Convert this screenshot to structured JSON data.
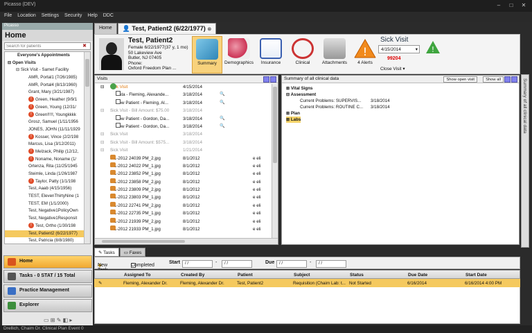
{
  "window": {
    "title": "Picasso (DEV)"
  },
  "menu": [
    "File",
    "Location",
    "Settings",
    "Security",
    "Help",
    "DDC"
  ],
  "left": {
    "app_label": "Picasso",
    "home_title": "Home",
    "search_placeholder": "Search for patients",
    "tree": [
      {
        "text": "Everyone's Appointments",
        "bold": true,
        "alert": false,
        "indent": 18
      },
      {
        "text": "⊟ Open Visits",
        "bold": true,
        "alert": false,
        "indent": 4
      },
      {
        "text": "⊟ Sick Visit - Samet Facility",
        "bold": false,
        "alert": false,
        "indent": 16
      },
      {
        "text": "AMR, Portal1 (7/26/1985)",
        "bold": false,
        "alert": false,
        "indent": 34
      },
      {
        "text": "AMR, Portal4 (8/13/1960)",
        "bold": false,
        "alert": false,
        "indent": 34
      },
      {
        "text": "Grant, Mary (3/21/1987)",
        "bold": false,
        "alert": false,
        "indent": 34
      },
      {
        "text": "Green, Heather (9/9/1",
        "bold": false,
        "alert": true,
        "indent": 34
      },
      {
        "text": "Green, Young (12/31/",
        "bold": false,
        "alert": true,
        "indent": 34
      },
      {
        "text": "Green!!!!!, Youngkkkk",
        "bold": false,
        "alert": true,
        "indent": 34
      },
      {
        "text": "Grosz, Samuel (1/11/1956",
        "bold": false,
        "alert": false,
        "indent": 34
      },
      {
        "text": "JONES, JOHN (11/11/1929",
        "bold": false,
        "alert": false,
        "indent": 34
      },
      {
        "text": "Kosser, Vince (2/2/198",
        "bold": false,
        "alert": true,
        "indent": 34
      },
      {
        "text": "Marcus, Lisa (3/12/2011)",
        "bold": false,
        "alert": false,
        "indent": 34
      },
      {
        "text": "Melzack, Philip (12/12,",
        "bold": false,
        "alert": true,
        "indent": 34
      },
      {
        "text": "Noname, Noname (1/",
        "bold": false,
        "alert": true,
        "indent": 34
      },
      {
        "text": "Ortenza, Rita (11/25/1945",
        "bold": false,
        "alert": false,
        "indent": 34
      },
      {
        "text": "Steimle, Linda (1/26/1987",
        "bold": false,
        "alert": false,
        "indent": 34
      },
      {
        "text": "Taylor, Patty (1/1/198",
        "bold": false,
        "alert": true,
        "indent": 34
      },
      {
        "text": "Test, Aaab (4/15/1956)",
        "bold": false,
        "alert": false,
        "indent": 34
      },
      {
        "text": "TEST, ElevenThirtyNine (1",
        "bold": false,
        "alert": false,
        "indent": 34
      },
      {
        "text": "TEST, EM (1/1/2000)",
        "bold": false,
        "alert": false,
        "indent": 34
      },
      {
        "text": "Test, Negative1PolicyOwn",
        "bold": false,
        "alert": false,
        "indent": 34
      },
      {
        "text": "Test, Negative1Responsit",
        "bold": false,
        "alert": false,
        "indent": 34
      },
      {
        "text": "Test, Ortho (1/30/198",
        "bold": false,
        "alert": true,
        "indent": 34
      },
      {
        "text": "Test, Patient2 (6/22/1977)",
        "bold": false,
        "alert": false,
        "indent": 34,
        "selected": true
      },
      {
        "text": "Test, Patricia (8/8/1980)",
        "bold": false,
        "alert": false,
        "indent": 34
      }
    ],
    "nav": [
      "Home",
      "Tasks - 0 STAT / 15 Total",
      "Practice Management",
      "Explorer"
    ]
  },
  "tabs": {
    "home": "Home",
    "patient": "Test, Patient2 (6/22/1977)"
  },
  "patient": {
    "name": "Test, Patient2",
    "info": [
      "Female 6/22/1977(37 y, 1 mo)",
      "50 Lakeview Ave",
      "Butler, NJ 07405",
      "Phone:",
      "Oxford Freedom Plan ..."
    ]
  },
  "toolbar": [
    "Summary",
    "Demographics",
    "Insurance",
    "Clinical",
    "Attachments",
    "4 Alerts"
  ],
  "visit": {
    "label": "Sick Visit",
    "date": "4/15/2014",
    "count": "99204",
    "close": "Close Visit"
  },
  "visits_panel": {
    "title": "Visits",
    "rows": [
      {
        "col1": "Sick Visit",
        "date": "4/15/2014",
        "extra": "",
        "kind": "visit-ok",
        "ind": 22
      },
      {
        "col1": "testa - Fleming, Alexande...",
        "date": "3/18/2014",
        "extra": "",
        "kind": "check",
        "ind": 30,
        "mag": true
      },
      {
        "col1": "New Patient - Fleming, Al...",
        "date": "3/18/2014",
        "extra": "",
        "kind": "check",
        "ind": 30,
        "mag": true
      },
      {
        "col1": "Sick Visit - Bill Amount: $75.00",
        "date": "3/18/2014",
        "extra": "",
        "kind": "grey",
        "ind": 22
      },
      {
        "col1": "New Patient - Gordon, Da...",
        "date": "3/18/2014",
        "extra": "",
        "kind": "check",
        "ind": 30,
        "mag": true
      },
      {
        "col1": "New Patient - Gordon, Da...",
        "date": "3/18/2014",
        "extra": "",
        "kind": "check",
        "ind": 30,
        "mag": true
      },
      {
        "col1": "Sick Visit",
        "date": "3/18/2014",
        "extra": "",
        "kind": "grey",
        "ind": 22
      },
      {
        "col1": "Sick Visit - Bill Amount: $575...",
        "date": "3/18/2014",
        "extra": "",
        "kind": "grey",
        "ind": 22
      },
      {
        "col1": "Sick Visit",
        "date": "1/21/2014",
        "extra": "",
        "kind": "grey",
        "ind": 22
      },
      {
        "col1": "8-1-2012 24039 PM_2.jpg",
        "date": "8/1/2012",
        "extra": "e eli",
        "kind": "img",
        "ind": 22
      },
      {
        "col1": "8-1-2012 24022 PM_1.jpg",
        "date": "8/1/2012",
        "extra": "e eli",
        "kind": "img",
        "ind": 22
      },
      {
        "col1": "8-1-2012 23852 PM_1.jpg",
        "date": "8/1/2012",
        "extra": "e eli",
        "kind": "img",
        "ind": 22
      },
      {
        "col1": "8-1-2012 23858 PM_2.jpg",
        "date": "8/1/2012",
        "extra": "e eli",
        "kind": "img",
        "ind": 22
      },
      {
        "col1": "8-1-2012 23809 PM_2.jpg",
        "date": "8/1/2012",
        "extra": "e eli",
        "kind": "img",
        "ind": 22
      },
      {
        "col1": "8-1-2012 23803 PM_1.jpg",
        "date": "8/1/2012",
        "extra": "e eli",
        "kind": "img",
        "ind": 22
      },
      {
        "col1": "8-1-2012 22741 PM_2.jpg",
        "date": "8/1/2012",
        "extra": "e eli",
        "kind": "img",
        "ind": 22
      },
      {
        "col1": "8-1-2012 22735 PM_1.jpg",
        "date": "8/1/2012",
        "extra": "e eli",
        "kind": "img",
        "ind": 22
      },
      {
        "col1": "8-1-2012 21939 PM_2.jpg",
        "date": "8/1/2012",
        "extra": "e eli",
        "kind": "img",
        "ind": 22
      },
      {
        "col1": "8-1-2012 21933 PM_1.jpg",
        "date": "8/1/2012",
        "extra": "e eli",
        "kind": "img",
        "ind": 22
      }
    ]
  },
  "clinical_panel": {
    "title": "Summary of all clinical data",
    "btn_open": "Show open visit",
    "btn_all": "Show all",
    "rows": [
      {
        "text": "⊞  Vital Signs",
        "date": "",
        "ind": 6,
        "bold": true
      },
      {
        "text": "⊟  Assessment",
        "date": "",
        "ind": 6,
        "bold": true
      },
      {
        "text": "Current Problems: SUPERVIS...",
        "date": "3/18/2014",
        "ind": 26,
        "bold": false
      },
      {
        "text": "Current Problems: ROUTINE C...",
        "date": "3/18/2014",
        "ind": 26,
        "bold": false
      },
      {
        "text": "⊞  Plan",
        "date": "",
        "ind": 6,
        "bold": true
      },
      {
        "text": "⊞  Labs",
        "date": "",
        "ind": 6,
        "bold": true
      }
    ],
    "side_label": "Summary of all clinical data"
  },
  "bottom_tabs": [
    "Tasks",
    "Faxes"
  ],
  "tasks": {
    "new_task": "New Task",
    "completed": "Completed",
    "start": "Start",
    "due": "Due",
    "date_placeholder": "/ /",
    "columns": [
      "Assigned To",
      "Created By",
      "Patient",
      "Subject",
      "Status",
      "Due Date",
      "Start Date"
    ],
    "rows": [
      [
        "Fleming, Alexander Dr.",
        "Fleming, Alexander Dr.",
        "Test, Patient2",
        "Requisition (Chaim Lab: t...",
        "Not Started",
        "6/16/2014",
        "6/16/2014 4:00 PM"
      ]
    ]
  },
  "status": "Drellich, Chaim Dr. Clinical Plan Event 0",
  "colors": {
    "highlight": "#f5c95e",
    "alert": "#e04d2a",
    "accent_blue": "#8080ee"
  }
}
